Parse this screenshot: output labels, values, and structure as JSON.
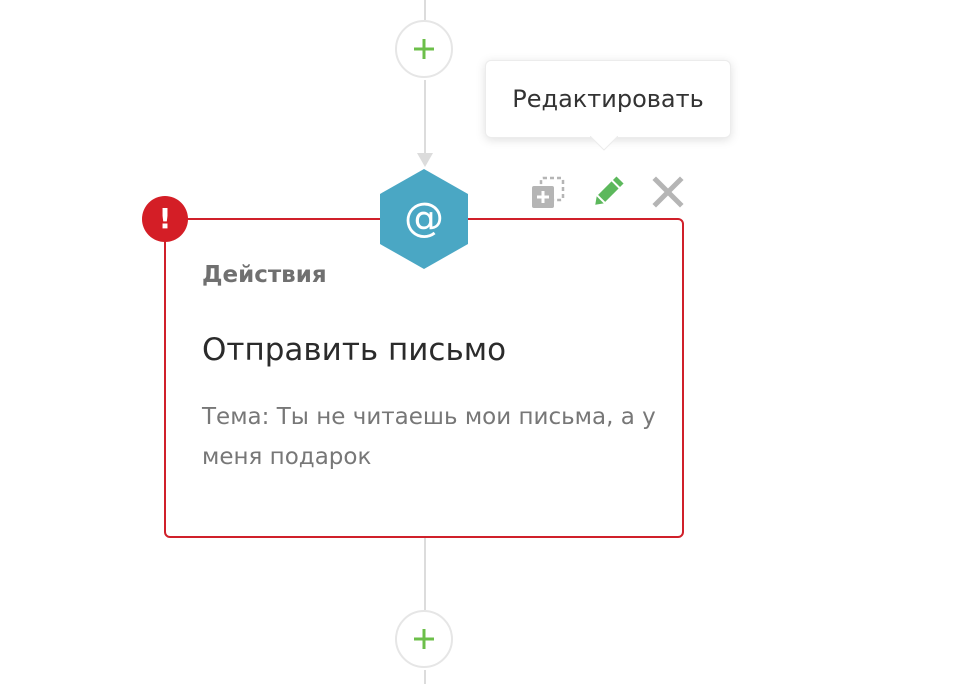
{
  "flow": {
    "add_step_symbol": "+",
    "action_card": {
      "category": "Действия",
      "title": "Отправить письмо",
      "subject": "Тема: Ты не читаешь мои письма, а у меня подарок",
      "node_icon_symbol": "@",
      "error_symbol": "!"
    },
    "toolbar": {
      "duplicate_icon": "duplicate-icon",
      "edit_icon": "pencil-icon",
      "delete_icon": "close-icon"
    },
    "tooltip": {
      "text": "Редактировать"
    }
  },
  "colors": {
    "add_plus": "#6cbf4a",
    "node_accent": "#4aa7c4",
    "error": "#d41e26",
    "edit_icon": "#5cb85c",
    "muted_icon": "#b5b5b5"
  }
}
